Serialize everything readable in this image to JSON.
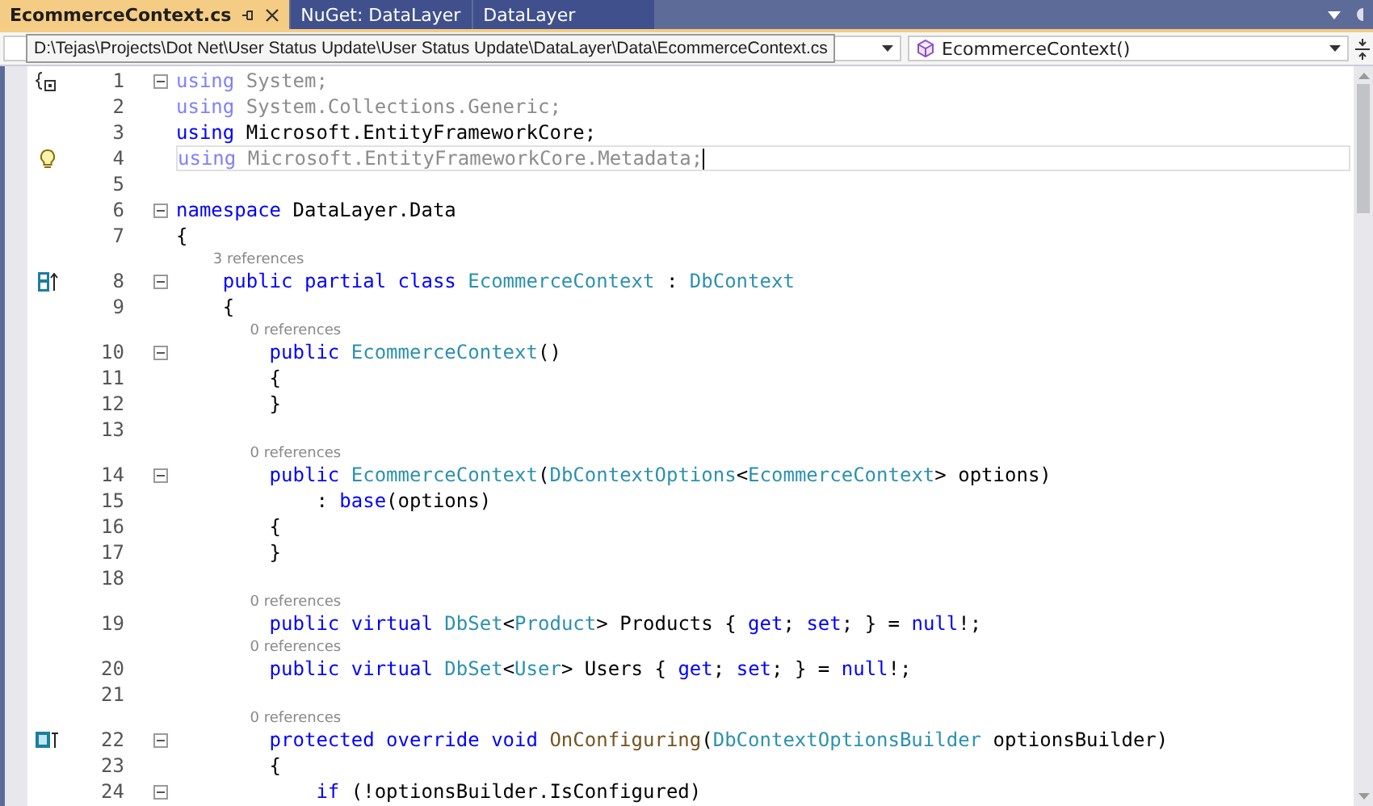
{
  "tabs": [
    {
      "label": "EcommerceContext.cs",
      "selected": true
    },
    {
      "label": "NuGet: DataLayer",
      "selected": false
    },
    {
      "label": "DataLayer",
      "selected": false
    }
  ],
  "navigation_bar": {
    "member_dropdown": "EcommerceContext()"
  },
  "tooltip": "D:\\Tejas\\Projects\\Dot Net\\User Status Update\\User Status Update\\DataLayer\\Data\\EcommerceContext.cs",
  "code_lines": [
    {
      "number": "1",
      "fold": true,
      "margin_icon": {
        "kind": "braces"
      },
      "current": false,
      "tokens": [
        {
          "kind": "dimkw",
          "text": "using"
        },
        {
          "kind": "dim",
          "text": " System;"
        }
      ]
    },
    {
      "number": "2",
      "fold": false,
      "current": false,
      "tokens": [
        {
          "kind": "dimkw",
          "text": "using"
        },
        {
          "kind": "dim",
          "text": " System.Collections.Generic;"
        }
      ]
    },
    {
      "number": "3",
      "fold": false,
      "current": false,
      "tokens": [
        {
          "kind": "kw",
          "text": "using"
        },
        {
          "kind": "plain",
          "text": " Microsoft.EntityFrameworkCore;"
        }
      ]
    },
    {
      "number": "4",
      "fold": false,
      "margin_icon": {
        "kind": "lightbulb"
      },
      "current": true,
      "tokens": [
        {
          "kind": "dimkw",
          "text": "using"
        },
        {
          "kind": "dim",
          "text": " Microsoft.EntityFrameworkCore.Metadata;"
        }
      ]
    },
    {
      "number": "5",
      "fold": false,
      "current": false
    },
    {
      "number": "6",
      "fold": true,
      "current": false,
      "tokens": [
        {
          "kind": "kw",
          "text": "namespace"
        },
        {
          "kind": "plain",
          "text": " DataLayer.Data"
        }
      ]
    },
    {
      "number": "7",
      "fold": false,
      "current": false,
      "tokens": [
        {
          "kind": "plain",
          "text": "{"
        }
      ]
    },
    {
      "number": "8",
      "lens": "3 references",
      "fold": true,
      "margin_icon": {
        "kind": "class"
      },
      "current": false,
      "tokens": [
        {
          "kind": "kw",
          "text": "    public partial class"
        },
        {
          "kind": "type",
          "text": " EcommerceContext"
        },
        {
          "kind": "plain",
          "text": " :"
        },
        {
          "kind": "type",
          "text": " DbContext"
        }
      ]
    },
    {
      "number": "9",
      "fold": false,
      "current": false,
      "tokens": [
        {
          "kind": "plain",
          "text": "    {"
        }
      ]
    },
    {
      "number": "10",
      "lens": "0 references",
      "fold": true,
      "current": false,
      "tokens": [
        {
          "kind": "kw",
          "text": "        public"
        },
        {
          "kind": "type",
          "text": " EcommerceContext"
        },
        {
          "kind": "plain",
          "text": "()"
        }
      ]
    },
    {
      "number": "11",
      "fold": false,
      "current": false,
      "tokens": [
        {
          "kind": "plain",
          "text": "        {"
        }
      ]
    },
    {
      "number": "12",
      "fold": false,
      "current": false,
      "tokens": [
        {
          "kind": "plain",
          "text": "        }"
        }
      ]
    },
    {
      "number": "13",
      "fold": false,
      "current": false
    },
    {
      "number": "14",
      "lens": "0 references",
      "fold": true,
      "current": false,
      "tokens": [
        {
          "kind": "kw",
          "text": "        public"
        },
        {
          "kind": "type",
          "text": " EcommerceContext"
        },
        {
          "kind": "plain",
          "text": "("
        },
        {
          "kind": "type",
          "text": "DbContextOptions"
        },
        {
          "kind": "plain",
          "text": "<"
        },
        {
          "kind": "type",
          "text": "EcommerceContext"
        },
        {
          "kind": "plain",
          "text": "> options)"
        }
      ]
    },
    {
      "number": "15",
      "fold": false,
      "current": false,
      "tokens": [
        {
          "kind": "plain",
          "text": "            :"
        },
        {
          "kind": "kw",
          "text": " base"
        },
        {
          "kind": "plain",
          "text": "(options)"
        }
      ]
    },
    {
      "number": "16",
      "fold": false,
      "current": false,
      "tokens": [
        {
          "kind": "plain",
          "text": "        {"
        }
      ]
    },
    {
      "number": "17",
      "fold": false,
      "current": false,
      "tokens": [
        {
          "kind": "plain",
          "text": "        }"
        }
      ]
    },
    {
      "number": "18",
      "fold": false,
      "current": false
    },
    {
      "number": "19",
      "lens": "0 references",
      "fold": false,
      "current": false,
      "tokens": [
        {
          "kind": "kw",
          "text": "        public virtual"
        },
        {
          "kind": "type",
          "text": " DbSet"
        },
        {
          "kind": "plain",
          "text": "<"
        },
        {
          "kind": "type",
          "text": "Product"
        },
        {
          "kind": "plain",
          "text": "> Products {"
        },
        {
          "kind": "kw",
          "text": " get"
        },
        {
          "kind": "plain",
          "text": ";"
        },
        {
          "kind": "kw",
          "text": " set"
        },
        {
          "kind": "plain",
          "text": "; } ="
        },
        {
          "kind": "kw",
          "text": " null"
        },
        {
          "kind": "plain",
          "text": "!;"
        }
      ]
    },
    {
      "number": "20",
      "lens": "0 references",
      "fold": false,
      "current": false,
      "tokens": [
        {
          "kind": "kw",
          "text": "        public virtual"
        },
        {
          "kind": "type",
          "text": " DbSet"
        },
        {
          "kind": "plain",
          "text": "<"
        },
        {
          "kind": "type",
          "text": "User"
        },
        {
          "kind": "plain",
          "text": "> Users {"
        },
        {
          "kind": "kw",
          "text": " get"
        },
        {
          "kind": "plain",
          "text": ";"
        },
        {
          "kind": "kw",
          "text": " set"
        },
        {
          "kind": "plain",
          "text": "; } ="
        },
        {
          "kind": "kw",
          "text": " null"
        },
        {
          "kind": "plain",
          "text": "!;"
        }
      ]
    },
    {
      "number": "21",
      "fold": false,
      "current": false
    },
    {
      "number": "22",
      "lens": "0 references",
      "fold": true,
      "margin_icon": {
        "kind": "override"
      },
      "current": false,
      "tokens": [
        {
          "kind": "kw",
          "text": "        protected override void"
        },
        {
          "kind": "method",
          "text": " OnConfiguring"
        },
        {
          "kind": "plain",
          "text": "("
        },
        {
          "kind": "type",
          "text": "DbContextOptionsBuilder"
        },
        {
          "kind": "plain",
          "text": " optionsBuilder)"
        }
      ]
    },
    {
      "number": "23",
      "fold": false,
      "current": false,
      "tokens": [
        {
          "kind": "plain",
          "text": "        {"
        }
      ]
    },
    {
      "number": "24",
      "fold": true,
      "current": false,
      "tokens": [
        {
          "kind": "kw",
          "text": "            if"
        },
        {
          "kind": "plain",
          "text": " (!optionsBuilder.IsConfigured)"
        }
      ]
    }
  ]
}
